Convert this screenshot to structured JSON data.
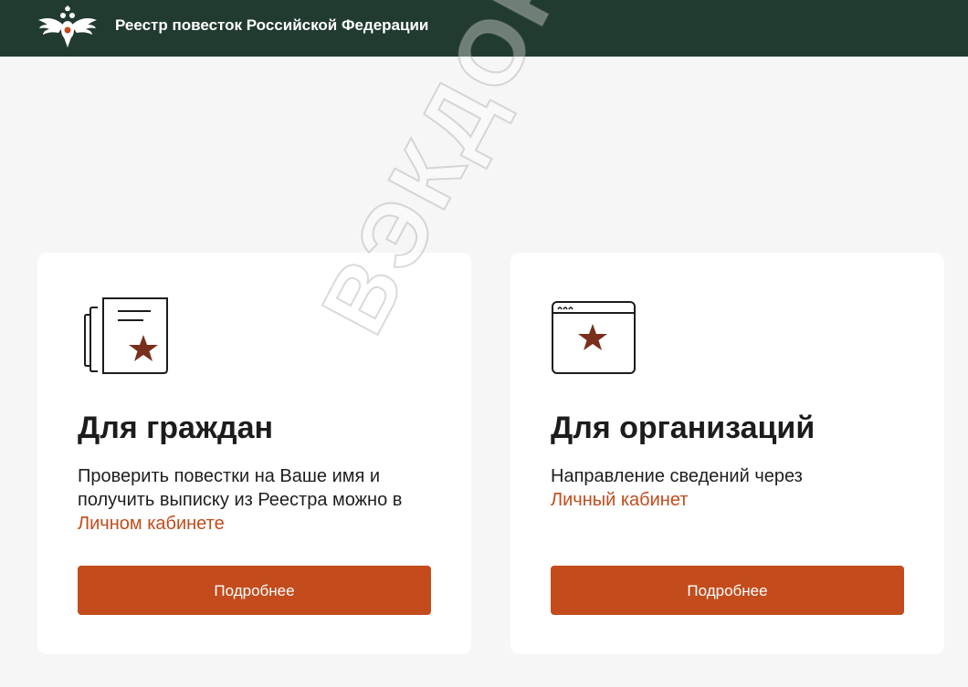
{
  "header": {
    "title": "Реестр повесток Российской Федерации",
    "emblem_icon": "double-headed-eagle-icon"
  },
  "cards": [
    {
      "icon": "document-star-icon",
      "title": "Для граждан",
      "text_before_link": "Проверить повестки на Ваше имя и получить выписку из Реестра можно в ",
      "link_text": "Личном кабинете",
      "button_label": "Подробнее"
    },
    {
      "icon": "browser-window-star-icon",
      "title": "Для организаций",
      "text_before_link": "Направление сведений через ",
      "link_text": "Личный кабинет",
      "button_label": "Подробнее"
    }
  ],
  "watermark": "ВЭКДОР",
  "colors": {
    "header_bg": "#223b31",
    "accent": "#c34b1c",
    "star": "#7a2f1c",
    "page_bg": "#f6f6f6"
  }
}
